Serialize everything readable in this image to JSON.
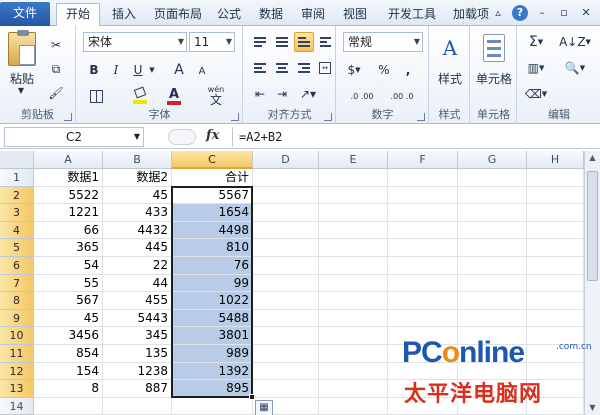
{
  "ribbon_tabs": [
    "文件",
    "开始",
    "插入",
    "页面布局",
    "公式",
    "数据",
    "审阅",
    "视图",
    "开发工具",
    "加载项"
  ],
  "active_tab": "开始",
  "groups": {
    "clipboard": {
      "label": "剪贴板",
      "paste": "粘贴"
    },
    "font": {
      "label": "字体",
      "font_name": "宋体",
      "font_size": "11",
      "bold": "B",
      "italic": "I",
      "underline": "U",
      "grow": "A",
      "shrink": "A",
      "wen": "wén",
      "fill_color_icon": "fill-color-icon",
      "font_color": "A"
    },
    "alignment": {
      "label": "对齐方式"
    },
    "number": {
      "label": "数字",
      "format": "常规",
      "currency": "$",
      "percent": "%",
      "comma": ",",
      "inc_decimal": ".0 .00",
      "dec_decimal": ".00 .0"
    },
    "styles": {
      "label": "样式",
      "text": "样式"
    },
    "cells": {
      "label": "单元格",
      "text": "单元格"
    },
    "editing": {
      "label": "编辑",
      "sum": "Σ"
    }
  },
  "formula_bar": {
    "name_box": "C2",
    "fx": "fx",
    "formula": "=A2+B2"
  },
  "sheet": {
    "columns": [
      "A",
      "B",
      "C",
      "D",
      "E",
      "F",
      "G",
      "H"
    ],
    "selected_column": "C",
    "rows": [
      [
        "数据1",
        "数据2",
        "合计"
      ],
      [
        "5522",
        "45",
        "5567"
      ],
      [
        "1221",
        "433",
        "1654"
      ],
      [
        "66",
        "4432",
        "4498"
      ],
      [
        "365",
        "445",
        "810"
      ],
      [
        "54",
        "22",
        "76"
      ],
      [
        "55",
        "44",
        "99"
      ],
      [
        "567",
        "455",
        "1022"
      ],
      [
        "45",
        "5443",
        "5488"
      ],
      [
        "3456",
        "345",
        "3801"
      ],
      [
        "854",
        "135",
        "989"
      ],
      [
        "154",
        "1238",
        "1392"
      ],
      [
        "8",
        "887",
        "895"
      ],
      [
        "",
        "",
        ""
      ]
    ],
    "row_numbers": [
      "1",
      "2",
      "3",
      "4",
      "5",
      "6",
      "7",
      "8",
      "9",
      "10",
      "11",
      "12",
      "13",
      "14"
    ]
  },
  "watermark": {
    "brand_p": "PC",
    "brand_o": "o",
    "brand_rest": "nline",
    "domain": ".com.cn",
    "tagline": "太平洋电脑网"
  },
  "colors": {
    "accent": "#1e5ba8",
    "selection_fill": "#b8cce8",
    "header_selected": "#f4c765"
  }
}
